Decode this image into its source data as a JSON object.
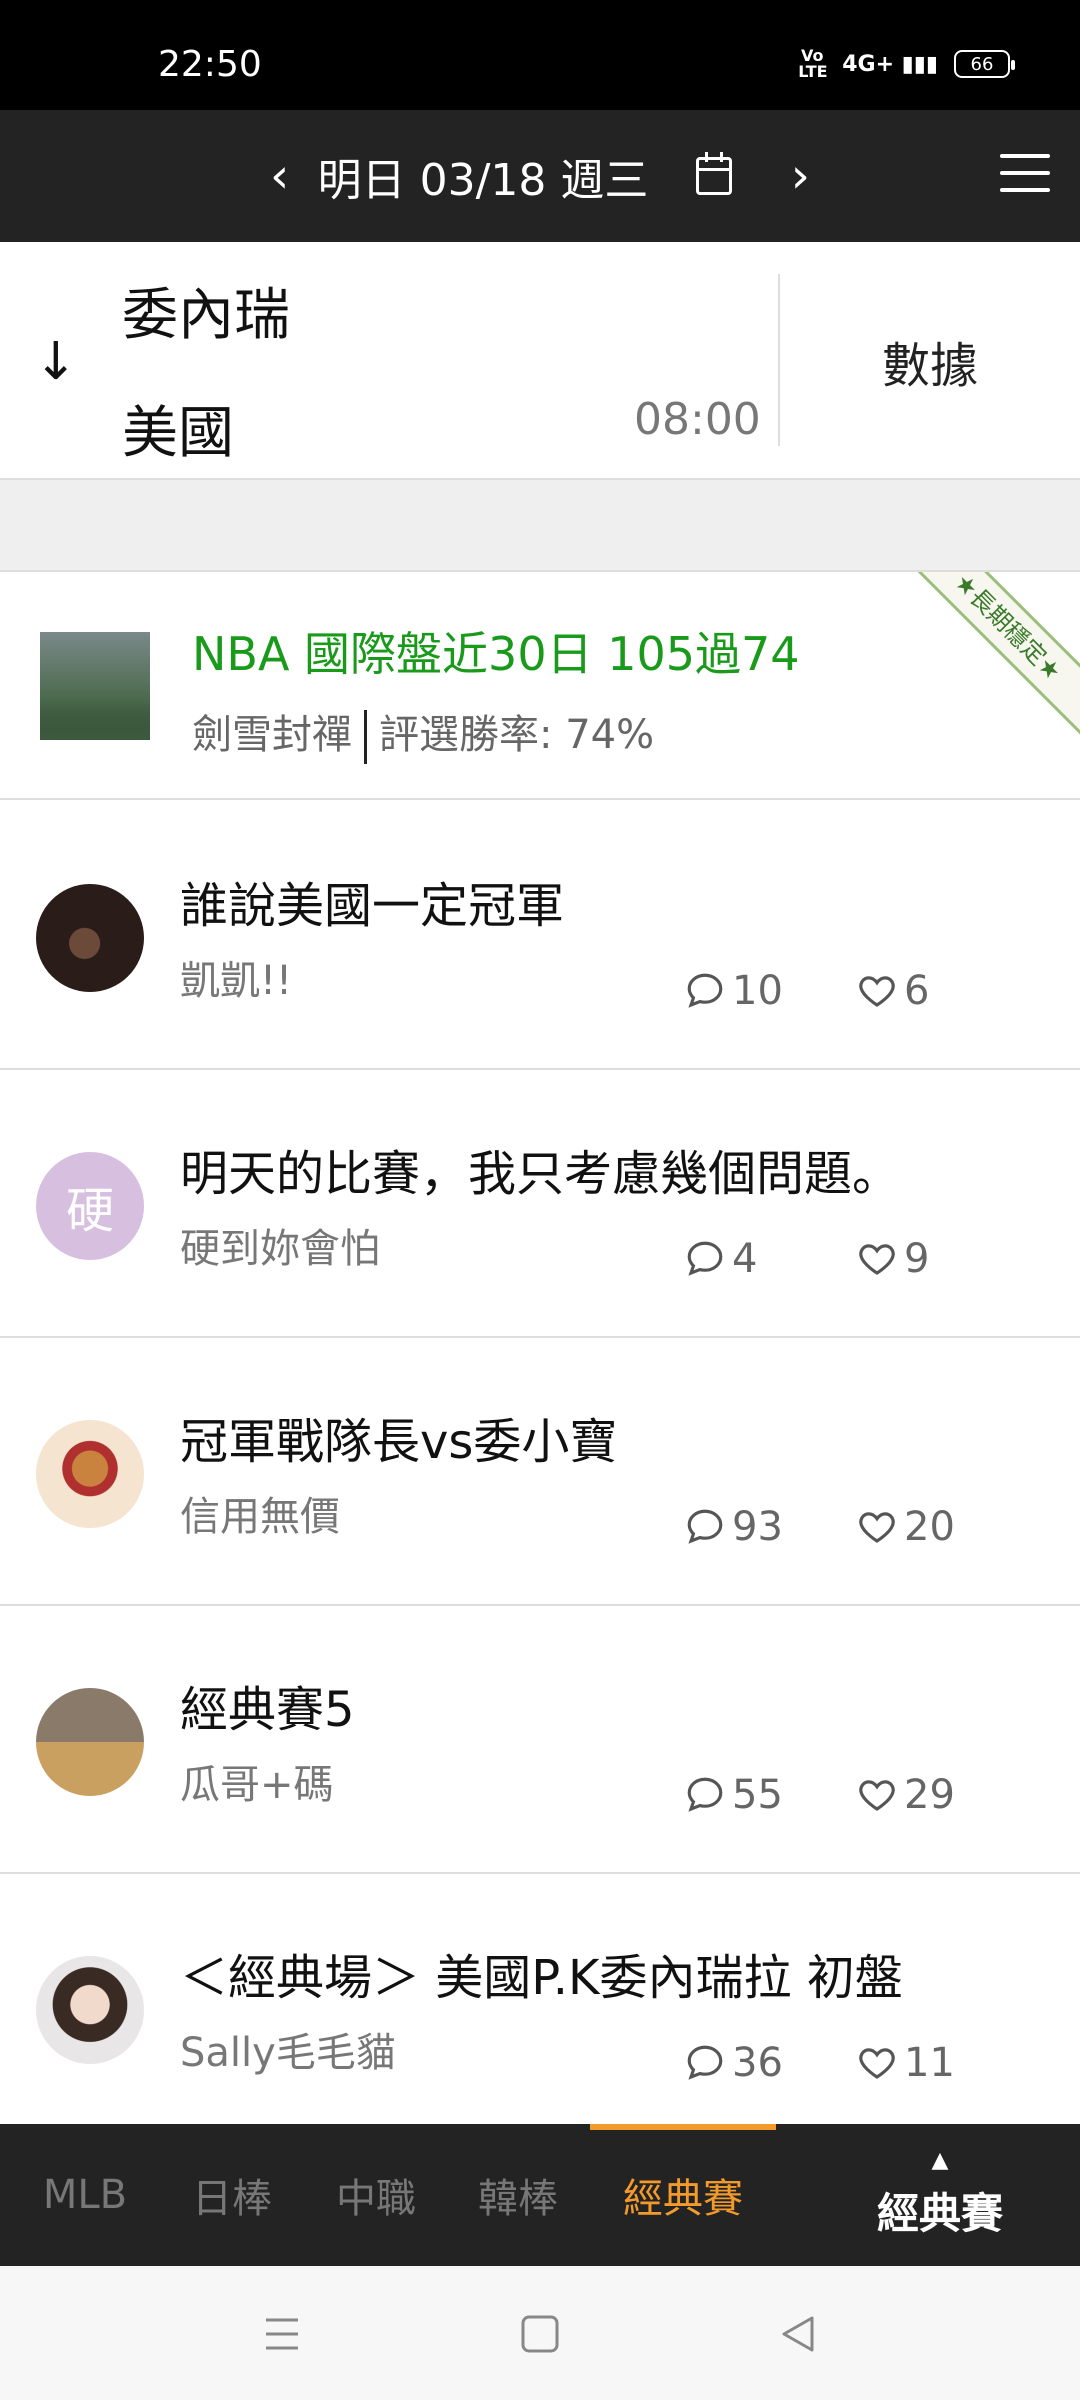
{
  "status_bar": {
    "time": "22:50",
    "volte": "Vo LTE",
    "network": "4G+",
    "battery": "66"
  },
  "header": {
    "prev": "‹",
    "date": "明日 03/18 週三",
    "next": "›"
  },
  "match": {
    "team1": "委內瑞",
    "team2": "美國",
    "time": "08:00",
    "data_label": "數據"
  },
  "featured": {
    "title": "NBA 國際盤近30日 105過74",
    "author": "劍雪封禪",
    "win_rate": "評選勝率: 74%",
    "ribbon": "★長期穩定★"
  },
  "posts": [
    {
      "title": "誰說美國一定冠軍",
      "author": "凱凱!!",
      "comments": "10",
      "likes": "6"
    },
    {
      "title": "明天的比賽，我只考慮幾個問題。",
      "author": "硬到妳會怕",
      "avatar_letter": "硬",
      "comments": "4",
      "likes": "9"
    },
    {
      "title": "冠軍戰隊長vs委小寶",
      "author": "信用無價",
      "comments": "93",
      "likes": "20"
    },
    {
      "title": "經典賽5",
      "author": "瓜哥+碼",
      "comments": "55",
      "likes": "29"
    },
    {
      "title": "＜經典場＞ 美國P.K委內瑞拉 初盤",
      "author": "Sally毛毛貓",
      "comments": "36",
      "likes": "11"
    }
  ],
  "tabs": [
    "MLB",
    "日棒",
    "中職",
    "韓棒",
    "經典賽"
  ],
  "current_tab": "經典賽",
  "colors": {
    "accent": "#f39a2c",
    "featured_green": "#1a9a1a",
    "bar": "#232323"
  }
}
